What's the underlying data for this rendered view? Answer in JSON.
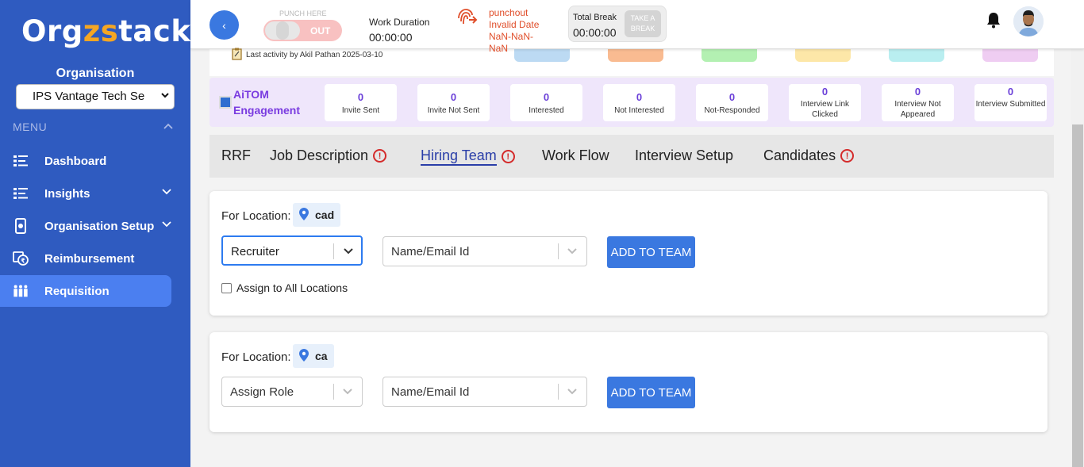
{
  "sidebar": {
    "logo": {
      "part1": "Org",
      "part2": "zs",
      "part3": "tack"
    },
    "org_label": "Organisation",
    "org_select_value": "IPS Vantage Tech Se",
    "menu_label": "MENU",
    "items": [
      {
        "label": "Dashboard",
        "icon": "list-icon"
      },
      {
        "label": "Insights",
        "icon": "list-icon"
      },
      {
        "label": "Organisation Setup",
        "icon": "phone-gear-icon"
      },
      {
        "label": "Reimbursement",
        "icon": "reimbursement-icon"
      },
      {
        "label": "Requisition",
        "icon": "people-icon"
      }
    ]
  },
  "header": {
    "back_icon": "‹",
    "punch_here": "PUNCH HERE",
    "punch_out": "OUT",
    "work_duration_label": "Work Duration",
    "work_duration_value": "00:00:00",
    "punch_status": "punchout",
    "punch_date": "Invalid Date",
    "punch_nan1": "NaN-NaN-",
    "punch_nan2": "NaN",
    "total_break_label": "Total Break",
    "total_break_value": "00:00:00",
    "take_break_1": "TAKE A",
    "take_break_2": "BREAK"
  },
  "last_activity": "Last activity by Akil Pathan 2025-03-10",
  "colors": {
    "swatches": [
      "#bcdaf3",
      "#f9bb91",
      "#b3f0b2",
      "#fde7a8",
      "#b9eef0",
      "#efcdf2"
    ],
    "accent": "#3a78e0",
    "purple": "#7a3ce0"
  },
  "engagement": {
    "title_line1": "AiTOM",
    "title_line2": "Engagement",
    "stats": [
      {
        "value": "0",
        "label": "Invite Sent"
      },
      {
        "value": "0",
        "label": "Invite Not Sent"
      },
      {
        "value": "0",
        "label": "Interested"
      },
      {
        "value": "0",
        "label": "Not Interested"
      },
      {
        "value": "0",
        "label": "Not-Responded"
      },
      {
        "value": "0",
        "label": "Interview Link Clicked"
      },
      {
        "value": "0",
        "label": "Interview Not Appeared"
      },
      {
        "value": "0",
        "label": "Interview Submitted"
      }
    ]
  },
  "tabs": [
    {
      "label": "RRF",
      "warning": false
    },
    {
      "label": "Job Description",
      "warning": true
    },
    {
      "label": "Hiring Team",
      "warning": true,
      "active": true
    },
    {
      "label": "Work Flow",
      "warning": false
    },
    {
      "label": "Interview Setup",
      "warning": false
    },
    {
      "label": "Candidates",
      "warning": true
    }
  ],
  "locations": [
    {
      "for_label": "For Location:",
      "location": "cad",
      "role_value": "Recruiter",
      "name_placeholder": "Name/Email Id",
      "add_label": "ADD TO TEAM",
      "assign_all_label": "Assign to All Locations"
    },
    {
      "for_label": "For Location:",
      "location": "ca",
      "role_value": "Assign Role",
      "name_placeholder": "Name/Email Id",
      "add_label": "ADD TO TEAM"
    }
  ]
}
